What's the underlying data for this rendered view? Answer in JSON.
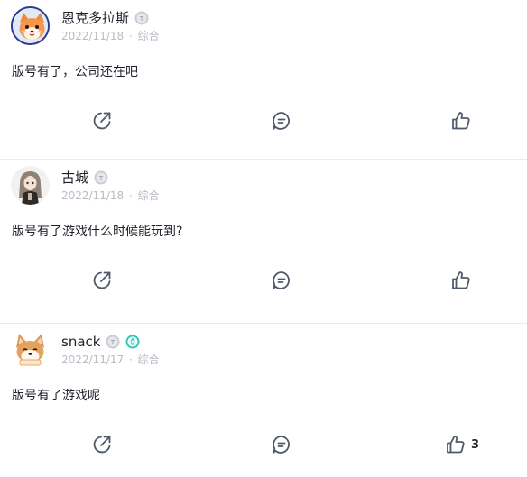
{
  "posts": [
    {
      "author": "恩克多拉斯",
      "date": "2022/11/18",
      "category": "综合",
      "content": "版号有了，公司还在吧",
      "like_count": ""
    },
    {
      "author": "古城",
      "date": "2022/11/18",
      "category": "综合",
      "content": "版号有了游戏什么时候能玩到?",
      "like_count": ""
    },
    {
      "author": "snack",
      "date": "2022/11/17",
      "category": "综合",
      "content": "版号有了游戏呢",
      "like_count": "3"
    }
  ],
  "meta_separator": "·",
  "colors": {
    "text": "#1d2129",
    "meta": "#b8bcc4",
    "icon": "#4e5969",
    "divider": "#e8eaed",
    "badge_gray": "#c9cdd4",
    "badge_teal": "#2bc4b5"
  },
  "icons": {
    "share": "share-icon",
    "comment": "comment-icon",
    "like": "thumbs-up-icon",
    "level_badge": "level-badge-icon",
    "medal_badge": "medal-badge-icon"
  }
}
